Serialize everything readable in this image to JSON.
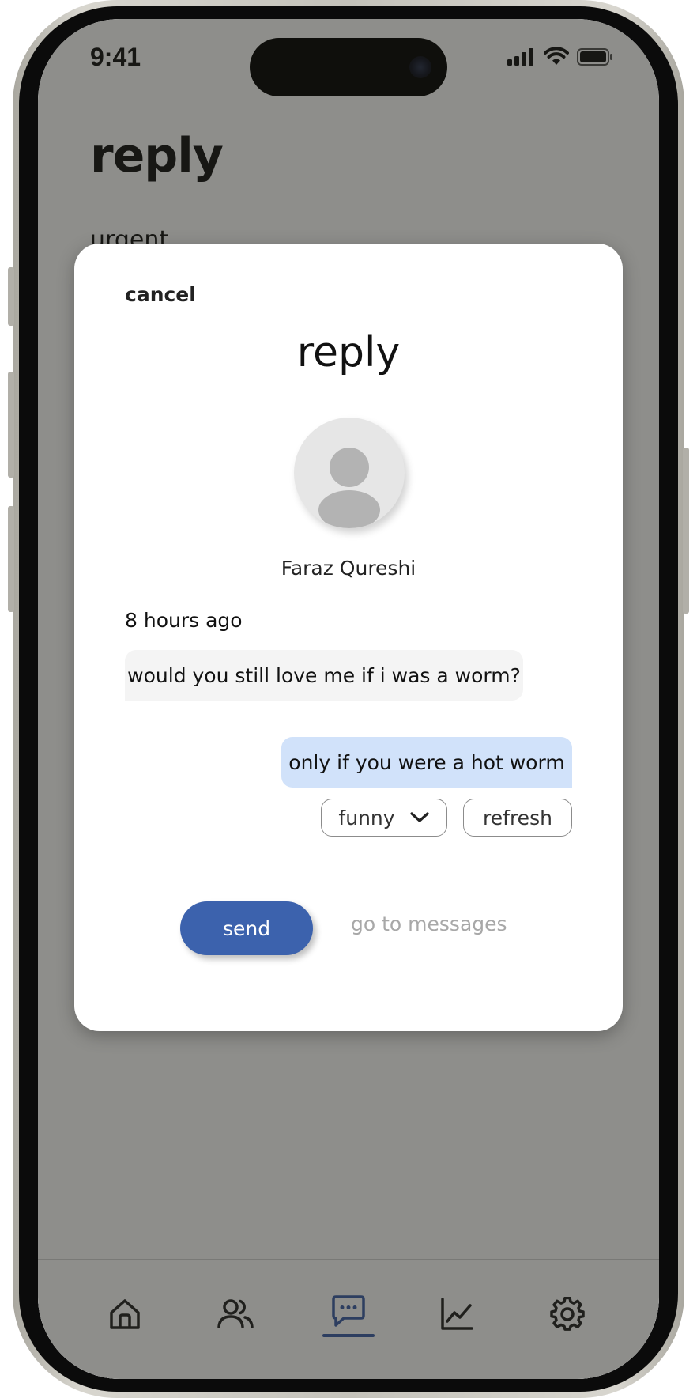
{
  "status_bar": {
    "time": "9:41"
  },
  "page": {
    "title": "reply",
    "subtitle": "urgent"
  },
  "modal": {
    "cancel_label": "cancel",
    "title": "reply",
    "sender_name": "Faraz Qureshi",
    "timestamp": "8 hours ago",
    "incoming_message": "would you still love me if i was a worm?",
    "suggested_reply": "only if you were a hot worm",
    "tone_selected": "funny",
    "refresh_label": "refresh",
    "send_label": "send",
    "goto_messages_label": "go to messages"
  },
  "nav": {
    "items": [
      {
        "icon": "home-icon",
        "active": false
      },
      {
        "icon": "users-icon",
        "active": false
      },
      {
        "icon": "messages-icon",
        "active": true
      },
      {
        "icon": "analytics-icon",
        "active": false
      },
      {
        "icon": "settings-icon",
        "active": false
      }
    ]
  },
  "colors": {
    "accent": "#3c62ad",
    "reply_bubble": "#d1e2fa",
    "incoming_bubble": "#f4f4f4",
    "overlay": "#1e1e18"
  }
}
